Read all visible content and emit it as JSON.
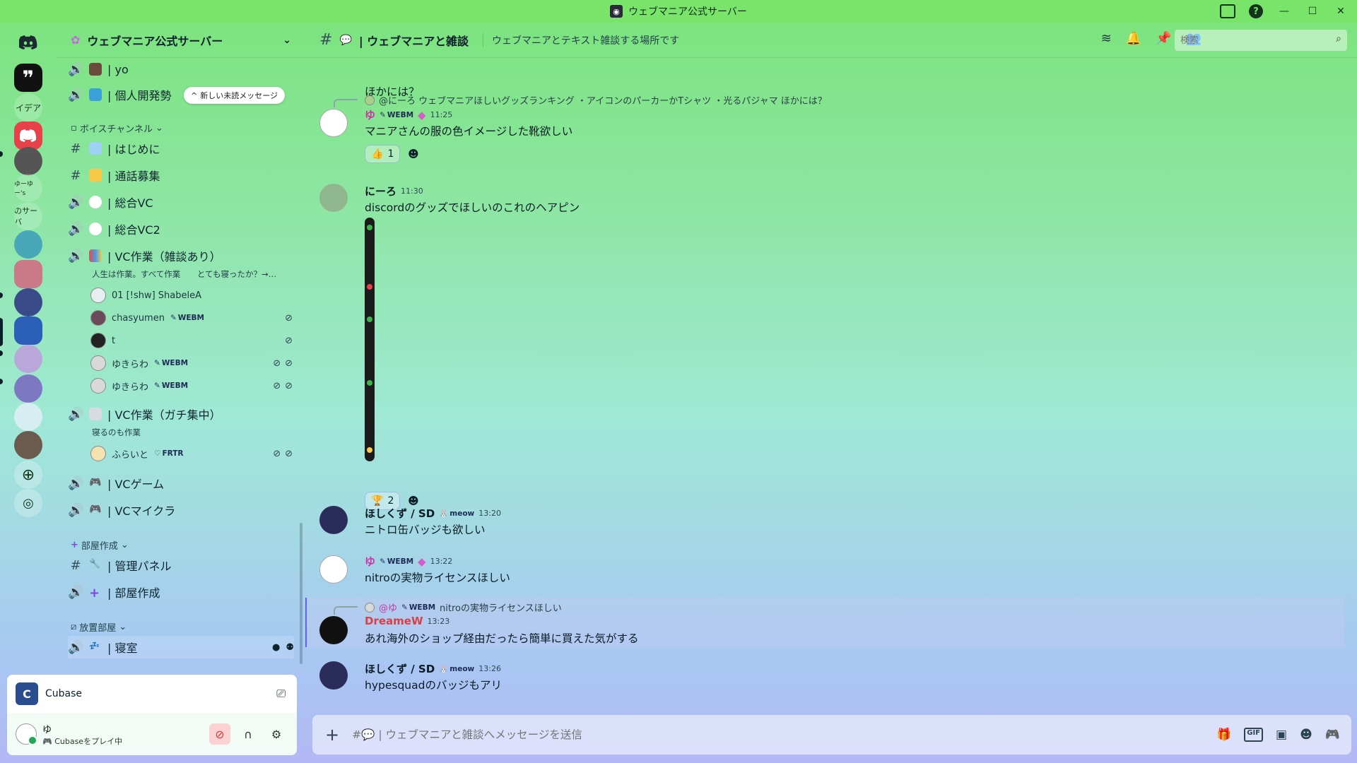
{
  "window": {
    "title": "ウェブマニア公式サーバー"
  },
  "rail": {
    "text_items": [
      "イデア",
      "ゆーゆー's",
      "のサーバ"
    ]
  },
  "sidebar": {
    "server_name": "ウェブマニア公式サーバー",
    "unread_pill": "新しい未読メッセージ",
    "top_channels": [
      {
        "label": "| yo"
      },
      {
        "label": "| 個人開発勢"
      }
    ],
    "category_voice": "ボイスチャンネル",
    "channels": [
      {
        "label": "| はじめに"
      },
      {
        "label": "| 通話募集"
      },
      {
        "label": "| 総合VC"
      },
      {
        "label": "| 総合VC2"
      },
      {
        "label": "| VC作業（雑談あり）"
      }
    ],
    "vc_work_desc": "人生は作業。すべて作業",
    "vc_work_status": "とても寝ったか？→…",
    "vc_users": [
      {
        "name": "01 [!shw] ShabeleA",
        "badge": ""
      },
      {
        "name": "chasyumen",
        "badge": "WEBM"
      },
      {
        "name": "t",
        "badge": ""
      },
      {
        "name": "ゆきらわ",
        "badge": "WEBM"
      },
      {
        "name": "ゆきらわ",
        "badge": "WEBM"
      }
    ],
    "vc_focus": {
      "label": "| VC作業（ガチ集中）",
      "desc": "寝るのも作業"
    },
    "vc_focus_users": [
      {
        "name": "ふらいと",
        "badge": "FRTR"
      }
    ],
    "vc_game": "| VCゲーム",
    "vc_minecraft": "| VCマイクラ",
    "category_room": "部屋作成",
    "admin_panel": "| 管理パネル",
    "room_create": "| 部屋作成",
    "category_afk": "放置部屋",
    "bedroom": "| 寝室"
  },
  "activity": {
    "app": "Cubase"
  },
  "user_panel": {
    "name": "ゆ",
    "status": "Cubaseをプレイ中"
  },
  "chat": {
    "channel_name": "| ウェブマニアと雑談",
    "topic": "ウェブマニアとテキスト雑談する場所です",
    "search_placeholder": "検索",
    "messages": [
      {
        "text": "ほかには？"
      },
      {
        "reply_to": "@にーろ ウェブマニアほしいグッズランキング ・アイコンのパーカーかTシャツ ・光るパジャマ ほかには？",
        "author": "ゆ",
        "badge": "WEBM",
        "time": "11:25",
        "text": "マニアさんの服の色イメージした靴欲しい",
        "reaction_count": "1"
      },
      {
        "author": "にーろ",
        "time": "11:30",
        "text": "discordのグッズでほしいのこれのヘアピン",
        "reaction_count": "2"
      },
      {
        "author": "ほしくず / SD",
        "badge": "meow",
        "time": "13:20",
        "text": "ニトロ缶バッジも欲しい"
      },
      {
        "author": "ゆ",
        "badge": "WEBM",
        "time": "13:22",
        "text": "nitroの実物ライセンスほしい"
      },
      {
        "reply_author": "@ゆ",
        "reply_badge": "WEBM",
        "reply_text": "nitroの実物ライセンスほしい",
        "author": "DreameW",
        "time": "13:23",
        "text": "あれ海外のショップ経由だったら簡単に買えた気がする"
      },
      {
        "author": "ほしくず / SD",
        "badge": "meow",
        "time": "13:26",
        "text": "hypesquadのバッジもアリ"
      }
    ],
    "composer_placeholder": "#💬 | ウェブマニアと雑談へメッセージを送信"
  },
  "colors": {
    "titlebar": "#78e46a",
    "accent": "#5865f2",
    "danger": "#d83c3e",
    "online": "#23a55a"
  }
}
